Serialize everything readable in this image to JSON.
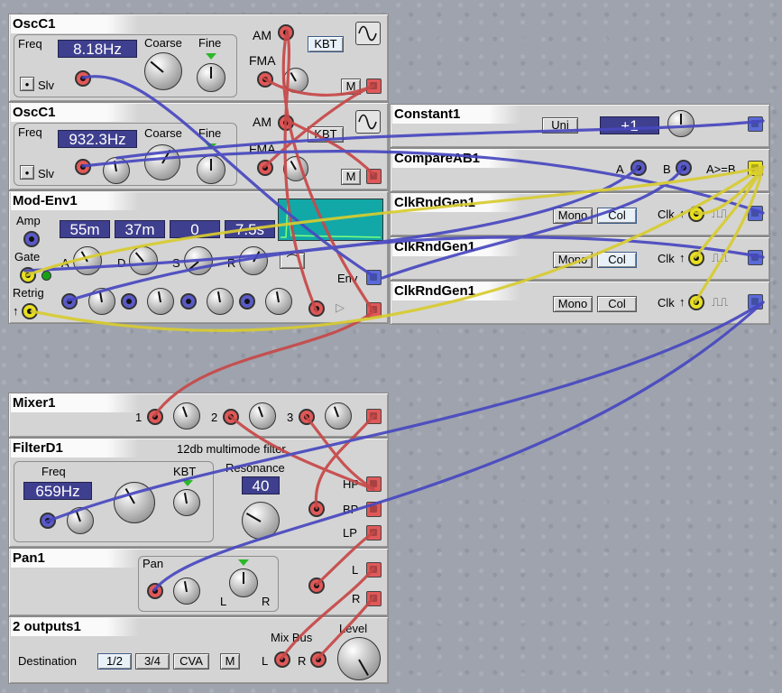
{
  "modules": {
    "osc1": {
      "title": "OscC1",
      "freq_label": "Freq",
      "freq_value": "8.18Hz",
      "coarse": "Coarse",
      "fine": "Fine",
      "slv": "Slv",
      "am": "AM",
      "fma": "FMA",
      "kbt": "KBT",
      "m": "M"
    },
    "osc2": {
      "title": "OscC1",
      "freq_label": "Freq",
      "freq_value": "932.3Hz",
      "coarse": "Coarse",
      "fine": "Fine",
      "slv": "Slv",
      "am": "AM",
      "fma": "FMA",
      "kbt": "KBT",
      "m": "M"
    },
    "env": {
      "title": "Mod-Env1",
      "amp": "Amp",
      "gate": "Gate",
      "retrig": "Retrig",
      "a": "A",
      "d": "D",
      "s": "S",
      "r": "R",
      "v1": "55m",
      "v2": "37m",
      "v3": "0",
      "v4": "7.5s",
      "env": "Env"
    },
    "constant": {
      "title": "Constant1",
      "uni": "Uni",
      "value": "+1"
    },
    "compare": {
      "title": "CompareAB1",
      "a": "A",
      "b": "B",
      "out": "A>=B"
    },
    "clk1": {
      "title": "ClkRndGen1",
      "mono": "Mono",
      "col": "Col",
      "clk": "Clk"
    },
    "clk2": {
      "title": "ClkRndGen1",
      "mono": "Mono",
      "col": "Col",
      "clk": "Clk"
    },
    "clk3": {
      "title": "ClkRndGen1",
      "mono": "Mono",
      "col": "Col",
      "clk": "Clk"
    },
    "mixer": {
      "title": "Mixer1",
      "in1": "1",
      "in2": "2",
      "in3": "3"
    },
    "filter": {
      "title": "FilterD1",
      "desc": "12db multimode filter",
      "freq_label": "Freq",
      "freq_value": "659Hz",
      "kbt": "KBT",
      "res_label": "Resonance",
      "res_value": "40",
      "hp": "HP",
      "bp": "BP",
      "lp": "LP"
    },
    "pan": {
      "title": "Pan1",
      "pan": "Pan",
      "l": "L",
      "r": "R",
      "out_l": "L",
      "out_r": "R"
    },
    "outputs": {
      "title": "2 outputs1",
      "dest": "Destination",
      "b12": "1/2",
      "b34": "3/4",
      "cva": "CVA",
      "m": "M",
      "mixbus": "Mix Bus",
      "level": "Level",
      "l": "L",
      "r": "R"
    }
  },
  "colors": {
    "red": "#e05858",
    "blue": "#5a5ac8",
    "yellow": "#e8e020",
    "cable_red": "#c84848",
    "cable_blue": "#4848c0",
    "cable_yellow": "#d8cc30"
  }
}
